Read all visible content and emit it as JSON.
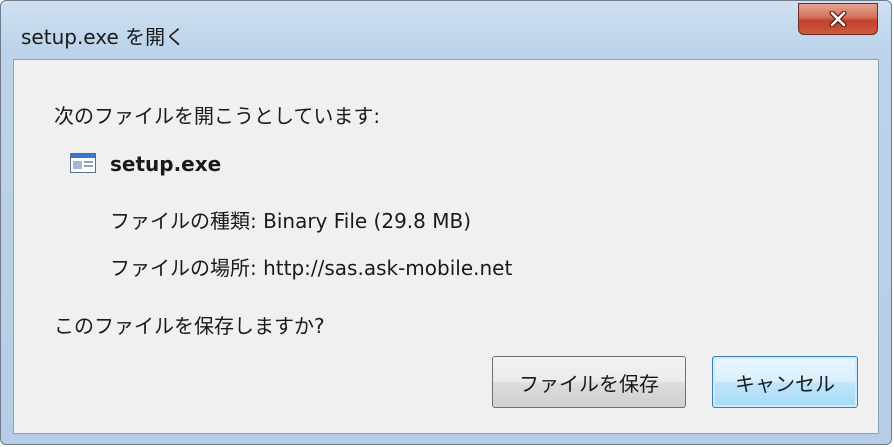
{
  "window": {
    "title": "setup.exe を開く",
    "close_icon": "close-x-icon"
  },
  "dialog": {
    "prompt": "次のファイルを開こうとしています:",
    "file": {
      "icon": "executable-file-icon",
      "name": "setup.exe"
    },
    "type_label": "ファイルの種類:",
    "type_value": "Binary File (29.8 MB)",
    "location_label": "ファイルの場所:",
    "location_value": "http://sas.ask-mobile.net",
    "question": "このファイルを保存しますか?"
  },
  "buttons": {
    "save_label": "ファイルを保存",
    "cancel_label": "キャンセル"
  },
  "colors": {
    "close_button": "#c9543a",
    "frame": "#bcd3ea",
    "content_bg": "#f0f0f0",
    "default_button_border": "#3c7fb1"
  }
}
